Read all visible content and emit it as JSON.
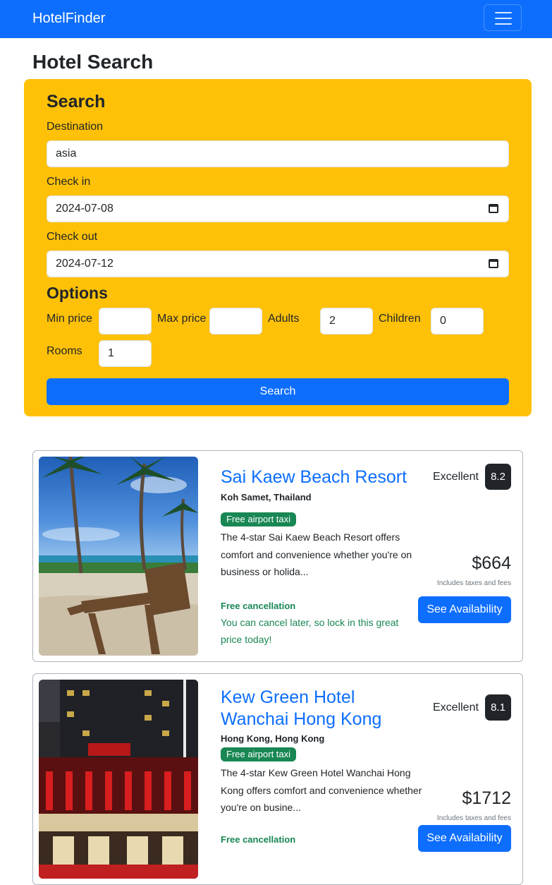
{
  "navbar": {
    "brand": "HotelFinder"
  },
  "page": {
    "title": "Hotel Search"
  },
  "search": {
    "heading": "Search",
    "destination_label": "Destination",
    "destination_value": "asia",
    "checkin_label": "Check in",
    "checkin_value": "2024-07-08",
    "checkout_label": "Check out",
    "checkout_value": "2024-07-12",
    "options_heading": "Options",
    "min_price_label": "Min price",
    "min_price_value": "",
    "max_price_label": "Max price",
    "max_price_value": "",
    "adults_label": "Adults",
    "adults_value": "2",
    "children_label": "Children",
    "children_value": "0",
    "rooms_label": "Rooms",
    "rooms_value": "1",
    "submit_label": "Search"
  },
  "results": [
    {
      "name": "Sai Kaew Beach Resort",
      "location": "Koh Samet, Thailand",
      "badge": "Free airport taxi",
      "description": "The 4-star Sai Kaew Beach Resort offers comfort and convenience whether you're on business or holida...",
      "free_cancellation": "Free cancellation",
      "cancel_note": "You can cancel later, so lock in this great price today!",
      "rating_text": "Excellent",
      "rating": "8.2",
      "price": "$664",
      "taxes_note": "Includes taxes and fees",
      "button": "See Availability"
    },
    {
      "name": "Kew Green Hotel Wanchai Hong Kong",
      "location": "Hong Kong, Hong Kong",
      "badge": "Free airport taxi",
      "description": "The 4-star Kew Green Hotel Wanchai Hong Kong offers comfort and convenience whether you're on busine...",
      "free_cancellation": "Free cancellation",
      "rating_text": "Excellent",
      "rating": "8.1",
      "price": "$1712",
      "taxes_note": "Includes taxes and fees",
      "button": "See Availability"
    }
  ],
  "colors": {
    "primary": "#0d6efd",
    "warning": "#ffc107",
    "success": "#198754",
    "dark": "#212529"
  }
}
